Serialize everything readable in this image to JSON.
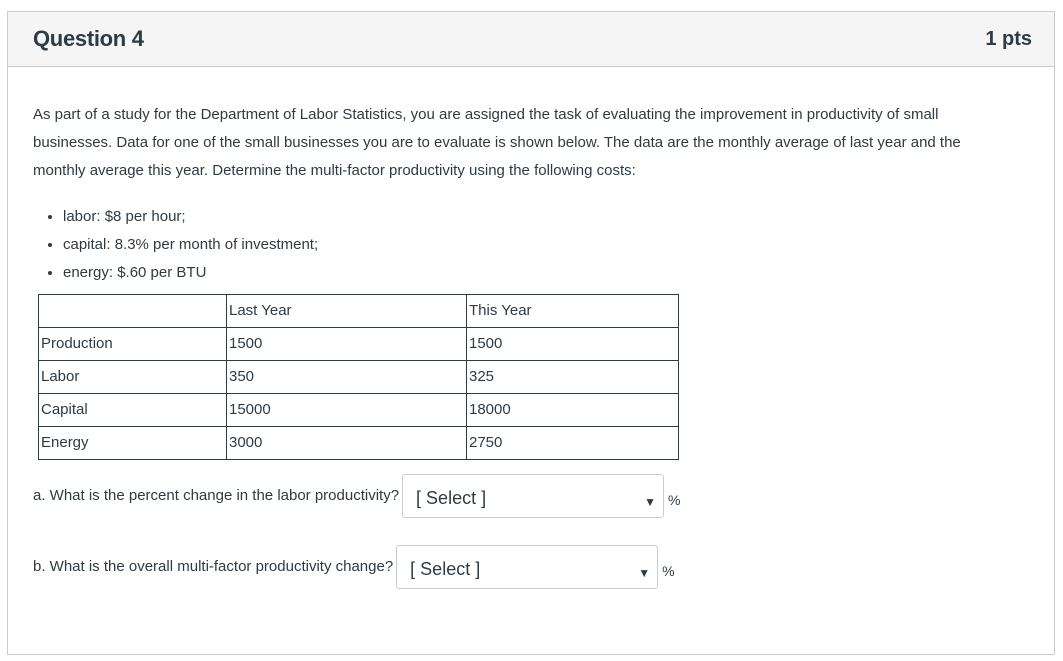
{
  "question": {
    "title": "Question 4",
    "points": "1 pts",
    "intro": "As part of a study for the Department of Labor Statistics, you are assigned the task of evaluating the improvement in productivity of small businesses. Data for one of the small businesses you are to evaluate is shown below. The data are the monthly average of last year and the monthly average this year. Determine the multi-factor productivity using the following costs:",
    "costs": [
      "labor: $8 per hour;",
      "capital: 8.3% per month of investment;",
      "energy: $.60 per BTU"
    ],
    "table": {
      "headers": [
        "",
        "Last Year",
        "This Year"
      ],
      "rows": [
        [
          "Production",
          "1500",
          "1500"
        ],
        [
          "Labor",
          "350",
          "325"
        ],
        [
          "Capital",
          "15000",
          "18000"
        ],
        [
          "Energy",
          "3000",
          "2750"
        ]
      ]
    },
    "answers": {
      "a": {
        "prompt": "a. What is the percent change in the labor productivity?",
        "selected": "[ Select ]",
        "unit": "%"
      },
      "b": {
        "prompt": "b. What is the overall multi-factor productivity change?",
        "selected": "[ Select ]",
        "unit": "%"
      }
    }
  }
}
